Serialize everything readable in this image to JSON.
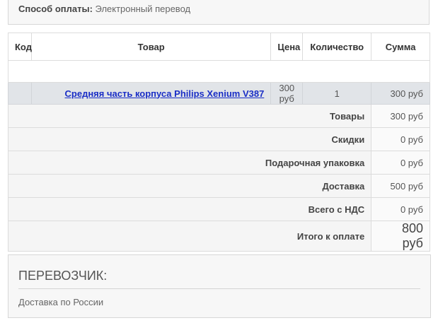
{
  "payment": {
    "label": "Способ оплаты:",
    "value": "Электронный перевод"
  },
  "table": {
    "headers": {
      "code": "Код",
      "product": "Товар",
      "price": "Цена",
      "quantity": "Количество",
      "sum": "Сумма"
    },
    "items": [
      {
        "code": "",
        "name": "Средняя часть корпуса Philips Xenium V387",
        "price": "300 руб",
        "quantity": "1",
        "sum": "300 руб"
      }
    ],
    "totals": [
      {
        "label": "Товары",
        "value": "300 руб"
      },
      {
        "label": "Скидки",
        "value": "0 руб"
      },
      {
        "label": "Подарочная упаковка",
        "value": "0 руб"
      },
      {
        "label": "Доставка",
        "value": "500 руб"
      },
      {
        "label": "Всего с НДС",
        "value": "0 руб"
      }
    ],
    "grand_total": {
      "label": "Итого к оплате",
      "value": "800 руб"
    }
  },
  "carrier": {
    "title": "ПЕРЕВОЗЧИК:",
    "text": "Доставка по России"
  }
}
